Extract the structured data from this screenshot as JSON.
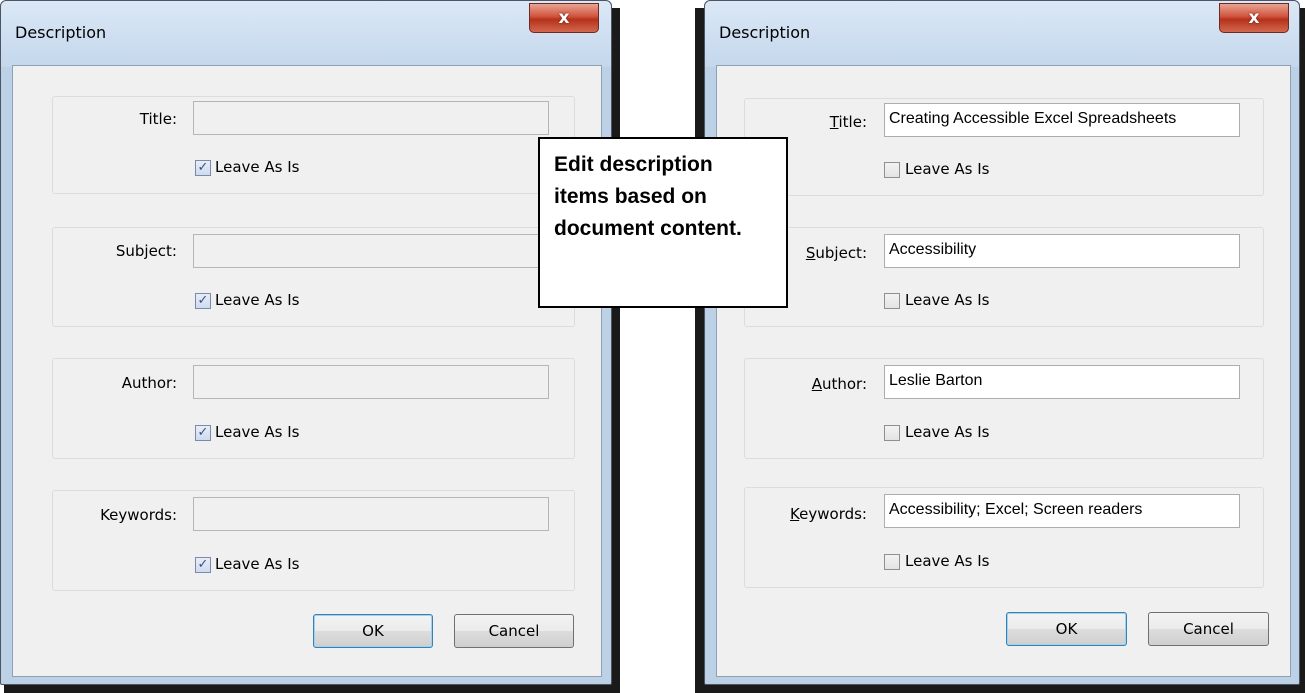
{
  "left_dialog": {
    "title": "Description",
    "close_glyph": "x",
    "fields": [
      {
        "label": "Title:",
        "value": "",
        "checkbox_label": "Leave As Is",
        "checked": true
      },
      {
        "label": "Subject:",
        "value": "",
        "checkbox_label": "Leave As Is",
        "checked": true
      },
      {
        "label": "Author:",
        "value": "",
        "checkbox_label": "Leave As Is",
        "checked": true
      },
      {
        "label": "Keywords:",
        "value": "",
        "checkbox_label": "Leave As Is",
        "checked": true
      }
    ],
    "ok_label": "OK",
    "cancel_label": "Cancel"
  },
  "right_dialog": {
    "title": "Description",
    "close_glyph": "x",
    "fields": [
      {
        "label": "Title:",
        "value": "Creating Accessible Excel Spreadsheets",
        "checkbox_label": "Leave As Is",
        "checked": false
      },
      {
        "label": "Subject:",
        "value": "Accessibility",
        "checkbox_label": "Leave As Is",
        "checked": false
      },
      {
        "label": "Author:",
        "value": "Leslie Barton",
        "checkbox_label": "Leave As Is",
        "checked": false
      },
      {
        "label": "Keywords:",
        "value": "Accessibility; Excel; Screen readers",
        "checkbox_label": "Leave As Is",
        "checked": false
      }
    ],
    "ok_label": "OK",
    "cancel_label": "Cancel"
  },
  "callout": {
    "text": "Edit description items based on document content."
  },
  "colors": {
    "frame": "#bcd0e6",
    "client": "#f0f0f0",
    "close_button": "#c9462f"
  },
  "icons": {
    "check": "check-icon",
    "close": "close-icon"
  }
}
